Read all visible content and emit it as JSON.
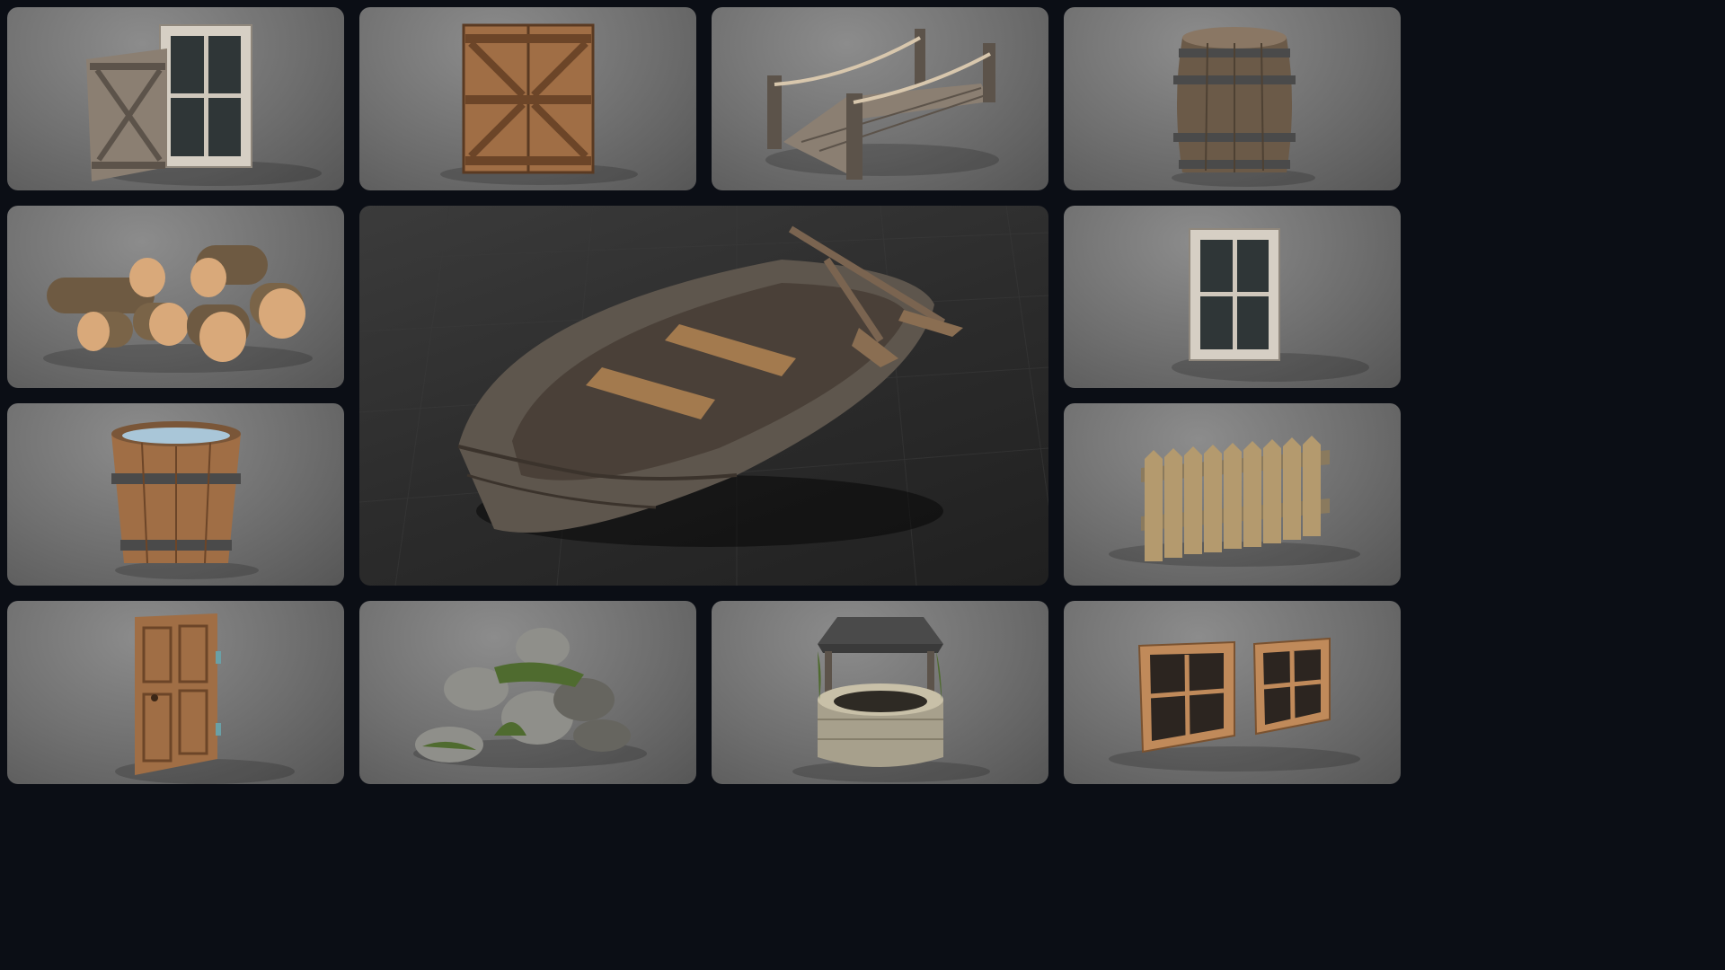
{
  "gallery": {
    "tiles": [
      {
        "id": "shutter-window",
        "icon": "shutter-window-icon"
      },
      {
        "id": "double-barn-door",
        "icon": "barn-door-icon"
      },
      {
        "id": "rope-bridge",
        "icon": "bridge-icon"
      },
      {
        "id": "barrel",
        "icon": "barrel-icon"
      },
      {
        "id": "log-pile",
        "icon": "log-pile-icon"
      },
      {
        "id": "rowboat",
        "icon": "rowboat-icon"
      },
      {
        "id": "single-window",
        "icon": "window-icon"
      },
      {
        "id": "water-bucket",
        "icon": "bucket-icon"
      },
      {
        "id": "picket-fence",
        "icon": "fence-icon"
      },
      {
        "id": "wooden-door",
        "icon": "door-icon"
      },
      {
        "id": "rock-pile",
        "icon": "rocks-icon"
      },
      {
        "id": "stone-well",
        "icon": "well-icon"
      },
      {
        "id": "window-pair",
        "icon": "window-pair-icon"
      }
    ],
    "colors": {
      "background": "#0b0e15",
      "tile": "#707070",
      "hero_tile": "#2c2c2c",
      "wood": "#a06e45",
      "weathered_wood": "#8b7f72"
    }
  }
}
